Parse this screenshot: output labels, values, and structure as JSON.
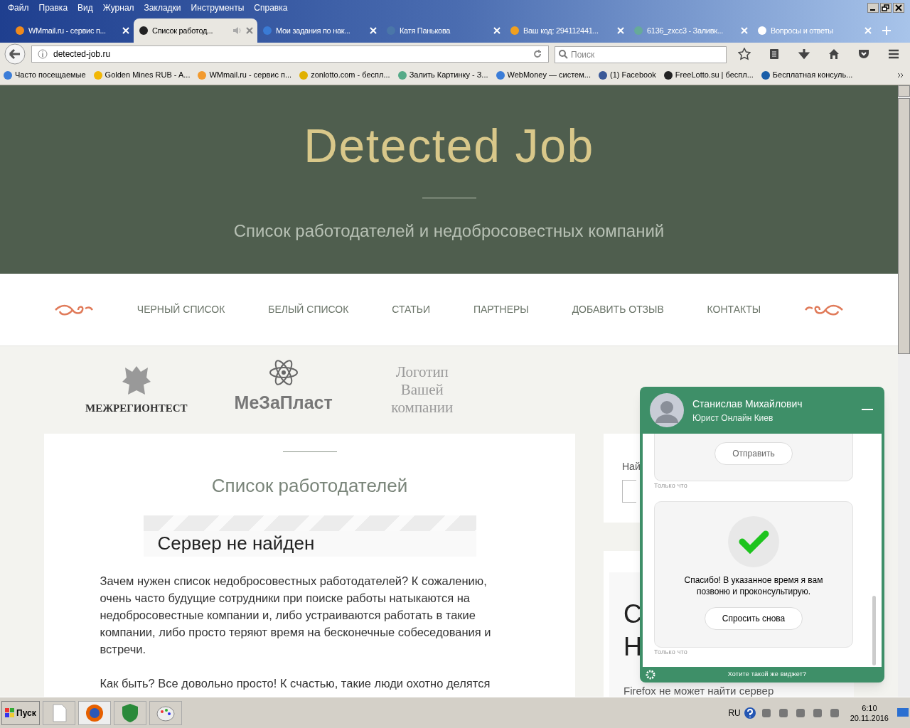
{
  "menu": [
    "Файл",
    "Правка",
    "Вид",
    "Журнал",
    "Закладки",
    "Инструменты",
    "Справка"
  ],
  "tabs": [
    {
      "label": "WMmail.ru - сервис п...",
      "selected": false,
      "audio": false
    },
    {
      "label": "Список работод...",
      "selected": true,
      "audio": true
    },
    {
      "label": "Мои задания по нак...",
      "selected": false,
      "audio": false
    },
    {
      "label": "Катя Панькова",
      "selected": false,
      "audio": false
    },
    {
      "label": "Ваш код: 294112441...",
      "selected": false,
      "audio": false
    },
    {
      "label": "6136_zxcc3 - Заливк...",
      "selected": false,
      "audio": false
    },
    {
      "label": "Вопросы и ответы",
      "selected": false,
      "audio": false
    }
  ],
  "address": "detected-job.ru",
  "search": {
    "placeholder": "Поиск"
  },
  "bookmarks": [
    "Часто посещаемые",
    "Golden Mines RUB - A...",
    "WMmail.ru - сервис п...",
    "zonlotto.com - беспл...",
    "Залить Картинку - З...",
    "WebMoney — систем...",
    "(1) Facebook",
    "FreeLotto.su | беспл...",
    "Бесплатная консуль..."
  ],
  "site": {
    "title": "Detected Job",
    "subtitle": "Список работодателей и недобросовестных компаний",
    "nav": [
      "ЧЕРНЫЙ СПИСОК",
      "БЕЛЫЙ СПИСОК",
      "СТАТЬИ",
      "ПАРТНЕРЫ",
      "ДОБАВИТЬ ОТЗЫВ",
      "КОНТАКТЫ"
    ],
    "partners": [
      {
        "kind": "emblem",
        "name": "МЕЖРЕГИОНТЕСТ"
      },
      {
        "kind": "atom",
        "name": "МеЗаПласт"
      },
      {
        "kind": "placeholder",
        "name": "Логотип Вашей компании"
      }
    ],
    "heading": "Список работодателей",
    "embed_error": "Сервер не найден",
    "paragraphs": [
      "Зачем нужен список недобросовестных работодателей? К сожалению, очень часто будущие сотрудники при поиске работы натыкаются на недобросовестные компании и, либо устраиваются работать в такие компании, либо просто теряют время на бесконечные собеседования и встречи.",
      "Как быть? Все довольно просто! К счастью, такие люди охотно делятся"
    ],
    "sidebar": {
      "search_label": "Най",
      "letters": [
        "С",
        "Н"
      ],
      "error": "Firefox не может найти сервер"
    }
  },
  "chat": {
    "name": "Станислав Михайлович",
    "role": "Юрист Онлайн Киев",
    "messages": [
      {
        "kind": "button",
        "button": "Отправить",
        "time": "Только что"
      },
      {
        "kind": "success",
        "text": "Спасибо! В указанное время я вам позвоню и проконсультирую.",
        "button": "Спросить снова",
        "time": "Только что"
      }
    ],
    "footer": "Хотите такой же виджет?"
  },
  "taskbar": {
    "start": "Пуск",
    "lang": "RU",
    "time": "6:10",
    "date": "20.11.2016"
  }
}
